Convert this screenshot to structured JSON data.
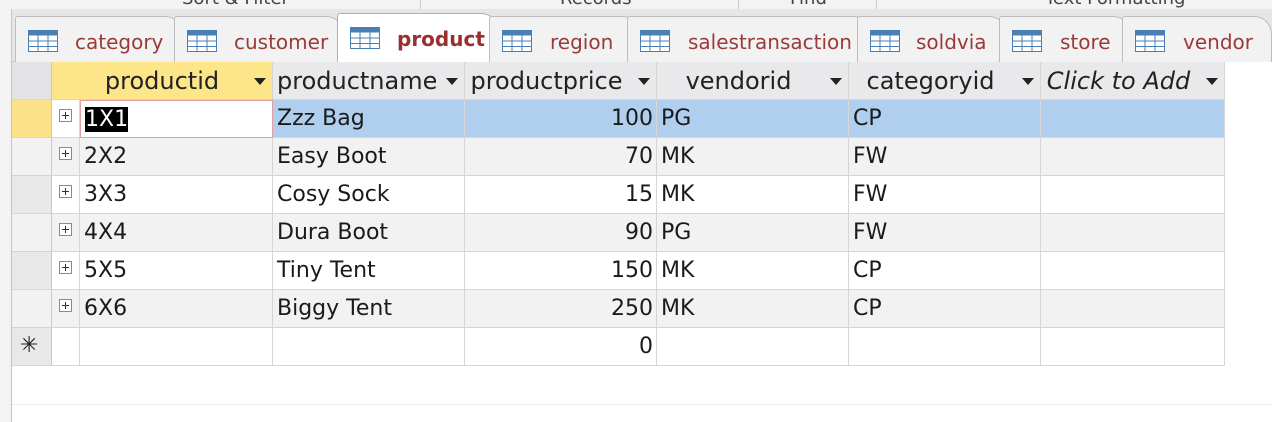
{
  "ribbon": {
    "groups": [
      "Sort & Filter",
      "Records",
      "Find",
      "Text Formatting"
    ]
  },
  "tabs": [
    {
      "label": "category",
      "active": false
    },
    {
      "label": "customer",
      "active": false
    },
    {
      "label": "product",
      "active": true
    },
    {
      "label": "region",
      "active": false
    },
    {
      "label": "salestransaction",
      "active": false
    },
    {
      "label": "soldvia",
      "active": false
    },
    {
      "label": "store",
      "active": false
    },
    {
      "label": "vendor",
      "active": false
    }
  ],
  "table": {
    "columns": [
      "productid",
      "productname",
      "productprice",
      "vendorid",
      "categoryid",
      "Click to Add"
    ],
    "rows": [
      {
        "productid": "1X1",
        "productname": "Zzz Bag",
        "productprice": "100",
        "vendorid": "PG",
        "categoryid": "CP"
      },
      {
        "productid": "2X2",
        "productname": "Easy Boot",
        "productprice": "70",
        "vendorid": "MK",
        "categoryid": "FW"
      },
      {
        "productid": "3X3",
        "productname": "Cosy Sock",
        "productprice": "15",
        "vendorid": "MK",
        "categoryid": "FW"
      },
      {
        "productid": "4X4",
        "productname": "Dura Boot",
        "productprice": "90",
        "vendorid": "PG",
        "categoryid": "FW"
      },
      {
        "productid": "5X5",
        "productname": "Tiny Tent",
        "productprice": "150",
        "vendorid": "MK",
        "categoryid": "CP"
      },
      {
        "productid": "6X6",
        "productname": "Biggy Tent",
        "productprice": "250",
        "vendorid": "MK",
        "categoryid": "CP"
      }
    ],
    "new_row": {
      "marker": "✳",
      "productprice": "0"
    }
  },
  "colors": {
    "tab_text": "#9a3a3a",
    "pk_header": "#fde68a",
    "selected_row": "#b0cfee",
    "record_selector_current": "#fbe28a"
  }
}
